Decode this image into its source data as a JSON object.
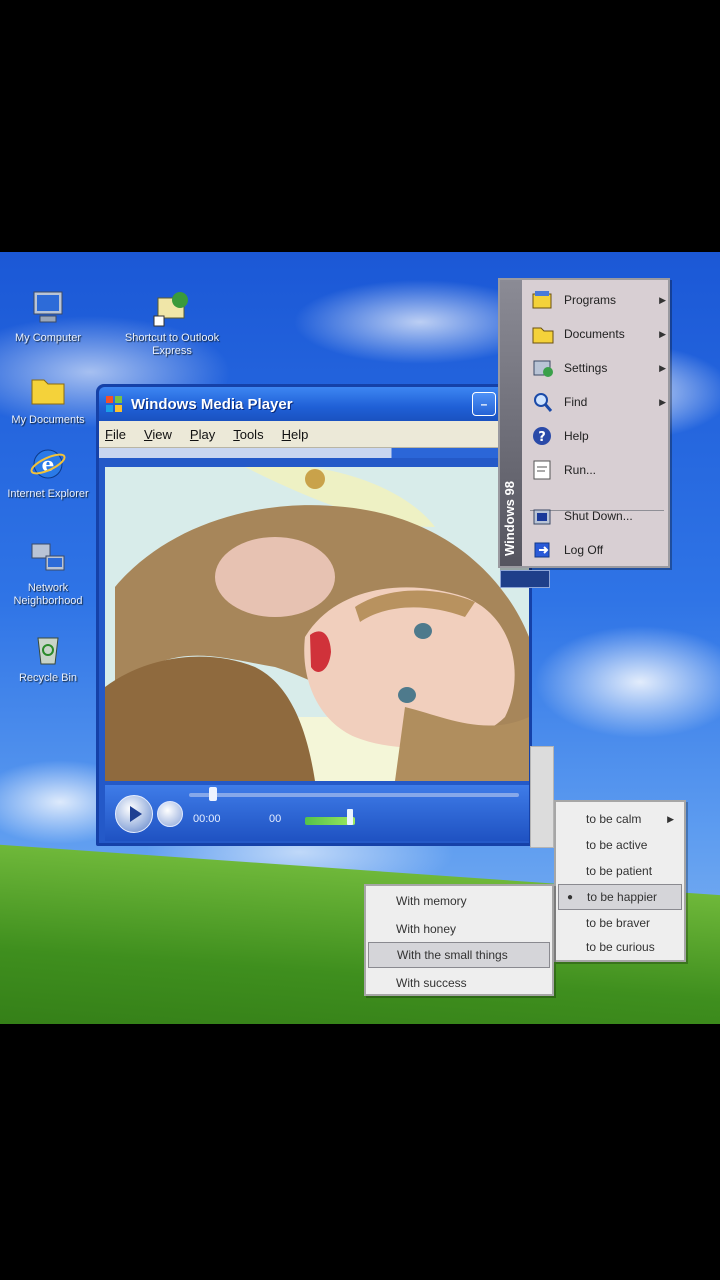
{
  "desktop_icons": [
    {
      "label": "My Computer",
      "icon": "monitor-icon"
    },
    {
      "label": "Shortcut to Outlook Express",
      "icon": "outlook-icon"
    },
    {
      "label": "My Documents",
      "icon": "folder-icon"
    },
    {
      "label": "Internet Explorer",
      "icon": "internet-explorer-icon"
    },
    {
      "label": "Network Neighborhood",
      "icon": "network-icon"
    },
    {
      "label": "Recycle Bin",
      "icon": "recycle-bin-icon"
    }
  ],
  "player": {
    "title": "Windows Media Player",
    "menu": [
      "File",
      "View",
      "Play",
      "Tools",
      "Help"
    ],
    "time_elapsed": "00:00",
    "time_total": "00",
    "seek_fraction": 0.06,
    "volume_fraction": 0.9
  },
  "start_menu": {
    "sidebar_label": "Windows 98",
    "items": [
      {
        "label": "Programs",
        "icon": "programs-icon",
        "has_submenu": true
      },
      {
        "label": "Documents",
        "icon": "documents-icon",
        "has_submenu": true
      },
      {
        "label": "Settings",
        "icon": "settings-icon",
        "has_submenu": true
      },
      {
        "label": "Find",
        "icon": "find-icon",
        "has_submenu": true
      },
      {
        "label": "Help",
        "icon": "help-icon",
        "has_submenu": false
      },
      {
        "label": "Run...",
        "icon": "run-icon",
        "has_submenu": false
      },
      {
        "label": "Shut Down...",
        "icon": "shutdown-icon",
        "has_submenu": false
      },
      {
        "label": "Log Off",
        "icon": "logoff-icon",
        "has_submenu": false
      }
    ]
  },
  "menu_with": {
    "items": [
      {
        "label": "With memory",
        "selected": false
      },
      {
        "label": "With honey",
        "selected": false
      },
      {
        "label": "With the small things",
        "selected": true
      },
      {
        "label": "With success",
        "selected": false
      }
    ]
  },
  "menu_be": {
    "items": [
      {
        "label": "to be calm",
        "checked": false,
        "has_submenu": true,
        "selected": false
      },
      {
        "label": "to be active",
        "checked": false,
        "has_submenu": false,
        "selected": false
      },
      {
        "label": "to be patient",
        "checked": false,
        "has_submenu": false,
        "selected": false
      },
      {
        "label": "to be happier",
        "checked": true,
        "has_submenu": false,
        "selected": true
      },
      {
        "label": "to be braver",
        "checked": false,
        "has_submenu": false,
        "selected": false
      },
      {
        "label": "to be curious",
        "checked": false,
        "has_submenu": false,
        "selected": false
      }
    ]
  },
  "colors": {
    "titlebar": "#1f5fd6",
    "menu_bg": "#eeeeee",
    "start_menu_bg": "#d8cfd3",
    "sky": "#2f74e6",
    "grass": "#3f8f1e"
  }
}
